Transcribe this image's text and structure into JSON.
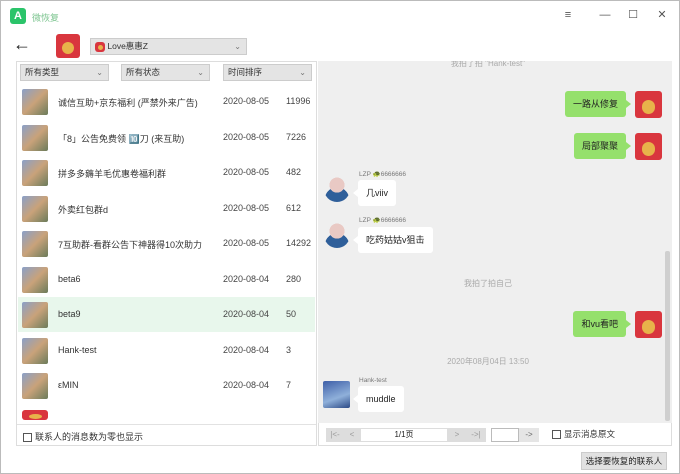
{
  "app": {
    "title": "微恢复",
    "logo": "A"
  },
  "window_controls": {
    "menu": "≡",
    "minimize": "—",
    "maximize": "☐",
    "close": "✕"
  },
  "header": {
    "back": "←",
    "account": "Love惠惠Z",
    "chevron": "⌄"
  },
  "filters": [
    {
      "label": "所有类型"
    },
    {
      "label": "所有状态"
    },
    {
      "label": "时间排序"
    }
  ],
  "contacts": [
    {
      "name": "诚信互助+京东福利 (严禁外来广告)",
      "date": "2020-08-05",
      "count": "11996"
    },
    {
      "name": "「8」公告免费领 🔟刀 (来互助)",
      "date": "2020-08-05",
      "count": "7226"
    },
    {
      "name": "拼多多薅羊毛优惠卷福利群",
      "date": "2020-08-05",
      "count": "482"
    },
    {
      "name": "外卖红包群d",
      "date": "2020-08-05",
      "count": "612"
    },
    {
      "name": "7互助群-看群公告下神器得10次助力",
      "date": "2020-08-05",
      "count": "14292"
    },
    {
      "name": "beta6",
      "date": "2020-08-04",
      "count": "280"
    },
    {
      "name": "beta9",
      "date": "2020-08-04",
      "count": "50"
    },
    {
      "name": "Hank-test",
      "date": "2020-08-04",
      "count": "3"
    },
    {
      "name": "εMIN",
      "date": "2020-08-04",
      "count": "7"
    }
  ],
  "left_footer": {
    "show_zero": "联系人的消息数为零也显示"
  },
  "chat": {
    "sys1": "我拍了拍 \"Hank-test\"",
    "m1": "一路从修复",
    "m2": "局部聚聚",
    "lzp_name": "LZP 🐢6666666",
    "m3": "几viiv",
    "m4": "吃药姑姑v狙击",
    "sys2": "我拍了拍自己",
    "m5": "和vu看吧",
    "timestamp": "2020年08月04日 13:50",
    "hank_name": "Hank-test",
    "m6": "muddle"
  },
  "pager": {
    "first": "|<-",
    "prev": "<",
    "page": "1/1页",
    "next": ">",
    "last": "->|",
    "go": "->",
    "show_raw": "显示消息原文"
  },
  "footer": {
    "select_contact": "选择要恢复的联系人"
  }
}
